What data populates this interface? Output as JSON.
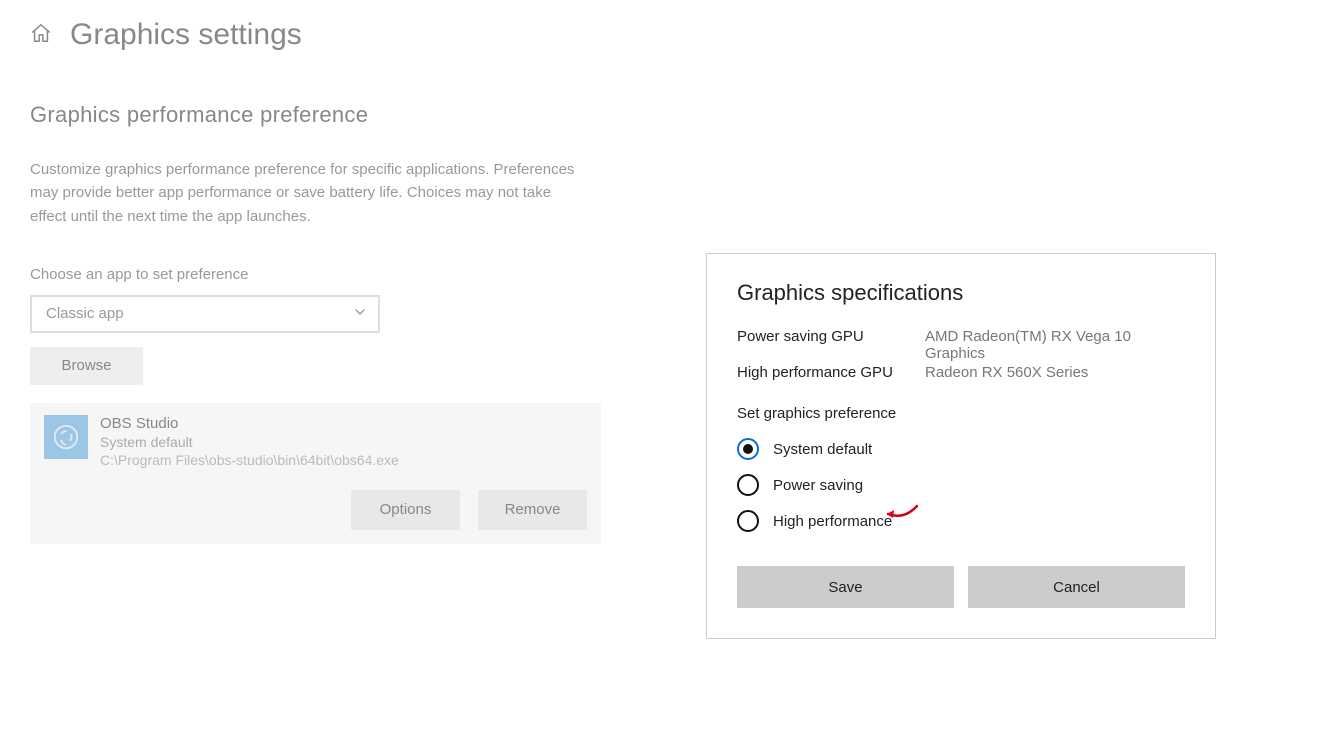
{
  "header": {
    "title": "Graphics settings"
  },
  "section": {
    "heading": "Graphics performance preference",
    "description": "Customize graphics performance preference for specific applications. Preferences may provide better app performance or save battery life. Choices may not take effect until the next time the app launches.",
    "choose_label": "Choose an app to set preference",
    "dropdown_value": "Classic app",
    "browse_label": "Browse"
  },
  "app": {
    "name": "OBS Studio",
    "preference": "System default",
    "path": "C:\\Program Files\\obs-studio\\bin\\64bit\\obs64.exe",
    "options_label": "Options",
    "remove_label": "Remove"
  },
  "panel": {
    "heading": "Graphics specifications",
    "specs": {
      "power_saving_label": "Power saving GPU",
      "power_saving_value": "AMD Radeon(TM) RX Vega 10 Graphics",
      "high_perf_label": "High performance GPU",
      "high_perf_value": "Radeon RX 560X Series"
    },
    "sub_heading": "Set graphics preference",
    "options": {
      "system_default": "System default",
      "power_saving": "Power saving",
      "high_performance": "High performance"
    },
    "selected": "system_default",
    "save_label": "Save",
    "cancel_label": "Cancel"
  }
}
